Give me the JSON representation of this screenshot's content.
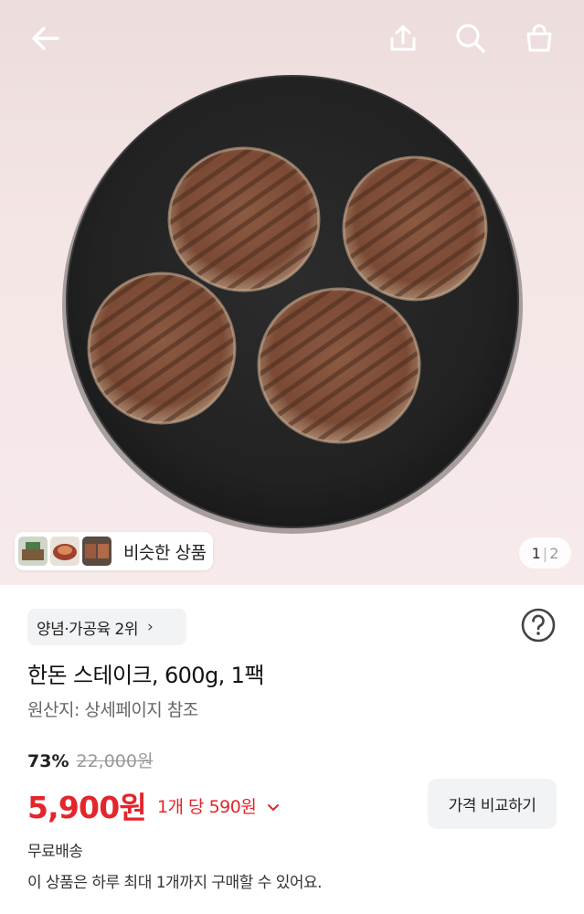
{
  "header": {
    "back_icon": "arrow-left-icon",
    "share_icon": "share-upload-icon",
    "search_icon": "search-icon",
    "cart_icon": "shopping-bag-icon"
  },
  "gallery": {
    "similar_label": "비슷한 상품",
    "current_page": "1",
    "separator": "|",
    "total_pages": "2"
  },
  "product": {
    "category_label": "양념·가공육 2위",
    "category_chevron": "›",
    "title": "한돈 스테이크, 600g, 1팩",
    "origin": "원산지: 상세페이지 참조",
    "discount": "73%",
    "original_price": "22,000원",
    "price": "5,900원",
    "unit_price": "1개 당 590원",
    "compare_label": "가격 비교하기",
    "shipping": "무료배송",
    "purchase_limit": "이 상품은 하루 최대 1개까지 구매할 수 있어요."
  },
  "colors": {
    "accent_red": "#e3262c",
    "chip_bg": "#f2f3f5"
  }
}
